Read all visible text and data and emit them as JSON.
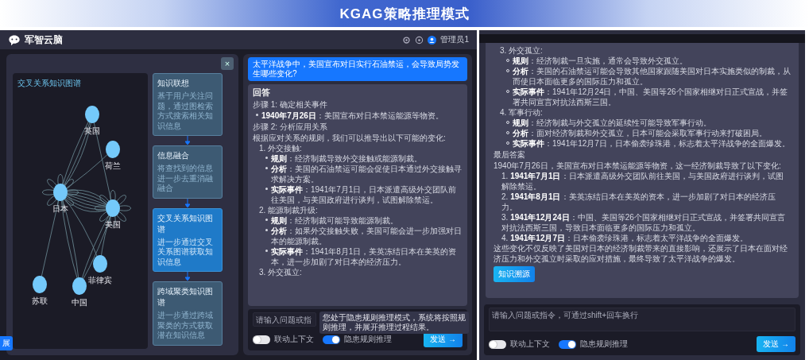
{
  "banner": {
    "title": "KGAG策略推理模式"
  },
  "left_screen": {
    "header": {
      "logo": "军智云脑",
      "user": "管理员1"
    },
    "graph_panel": {
      "close": "×",
      "title": "交叉关系知识图谱",
      "side_button": "展",
      "nodes": [
        {
          "label": "英国"
        },
        {
          "label": "荷兰"
        },
        {
          "label": "日本"
        },
        {
          "label": "美国"
        },
        {
          "label": "菲律宾"
        },
        {
          "label": "苏联"
        },
        {
          "label": "中国"
        }
      ]
    },
    "steps": [
      {
        "title": "知识联想",
        "description": "基于用户关注问题，通过图检索方式搜索相关知识信息",
        "selected": false
      },
      {
        "title": "信息融合",
        "description": "将查找到的信息进一步去重消融融合",
        "selected": false
      },
      {
        "title": "交叉关系知识图谱",
        "description": "进一步通过交叉关系图谱获取知识信息",
        "selected": true
      },
      {
        "title": "跨域聚类知识图谱",
        "description": "进一步通过跨域聚类的方式获取潜在知识信息",
        "selected": false
      }
    ],
    "chat": {
      "question": "太平洋战争中，美国宣布对日实行石油禁运，会导致局势发生哪些变化?",
      "answer": {
        "blocks": [
          {
            "kind": "title",
            "text": "回答"
          },
          {
            "kind": "step",
            "text": "步骤 1: 确定相关事件"
          },
          {
            "kind": "bullet",
            "text": "**1940年7月26日**：美国宣布对日本禁运能源等物资。"
          },
          {
            "kind": "step",
            "text": "步骤 2: 分析应用关系"
          },
          {
            "kind": "para",
            "text": "根据应对关系的规则，我们可以推导出以下可能的变化:"
          },
          {
            "kind": "item",
            "text": "1. 外交接触:"
          },
          {
            "kind": "sub",
            "text": "**规则**：经济制裁导致外交接触或能源制裁。"
          },
          {
            "kind": "sub",
            "text": "**分析**：美国的石油禁运可能会促使日本通过外交接触寻求解决方案。"
          },
          {
            "kind": "sub",
            "text": "**实际事件**：1941年7月1日，日本派遣高级外交团队前往美国，与美国政府进行谈判，试图解除禁运。"
          },
          {
            "kind": "item",
            "text": "2. 能源制裁升级:"
          },
          {
            "kind": "sub",
            "text": "**规则**：经济制裁可能导致能源制裁。"
          },
          {
            "kind": "sub",
            "text": "**分析**：如果外交接触失败，美国可能会进一步加强对日本的能源制裁。"
          },
          {
            "kind": "sub",
            "text": "**实际事件**：1941年8月1日，美英冻结日本在美英的资本，进一步加剧了对日本的经济压力。"
          },
          {
            "kind": "item",
            "text": "3. 外交孤立:"
          }
        ]
      },
      "input": {
        "placeholder": "请输入问题或指",
        "tooltip": "您处于隐患规则推理模式，系统将按照规则推理，并展开推理过程结果。"
      },
      "toggles": [
        {
          "label": "联动上下文",
          "on": false
        },
        {
          "label": "隐患规则推理",
          "on": true
        }
      ],
      "send": "发送 →"
    }
  },
  "right_screen": {
    "answer": {
      "blocks": [
        {
          "kind": "item",
          "text": "3. 外交孤立:"
        },
        {
          "kind": "sub",
          "text": "**规则**：经济制裁一旦实施，通常会导致外交孤立。"
        },
        {
          "kind": "sub",
          "text": "**分析**：美国的石油禁运可能会导致其他国家跟随美国对日本实施类似的制裁，从而使日本面临更多的国际压力和孤立。"
        },
        {
          "kind": "sub",
          "text": "**实际事件**：1941年12月24日，中国、美国等26个国家相继对日正式宣战，并签署共同宣言对抗法西斯三国。"
        },
        {
          "kind": "item",
          "text": "4. 军事行动:"
        },
        {
          "kind": "sub",
          "text": "**规则**：经济制裁与外交孤立的延续性可能导致军事行动。"
        },
        {
          "kind": "sub",
          "text": "**分析**：面对经济制裁和外交孤立，日本可能会采取军事行动来打破困局。"
        },
        {
          "kind": "sub",
          "text": "**实际事件**：1941年12月7日，日本偷袭珍珠港，标志着太平洋战争的全面爆发。"
        },
        {
          "kind": "step",
          "text": "最后答案"
        },
        {
          "kind": "para",
          "text": "1940年7月26日，美国宣布对日本禁运能源等物资，这一经济制裁导致了以下变化:"
        },
        {
          "kind": "num",
          "text": "1. **1941年7月1日**：日本派遣高级外交团队前往美国，与美国政府进行谈判，试图解除禁运。"
        },
        {
          "kind": "num",
          "text": "2. **1941年8月1日**：美英冻结日本在美英的资本，进一步加剧了对日本的经济压力。"
        },
        {
          "kind": "num",
          "text": "3. **1941年12月24日**：中国、美国等26个国家相继对日正式宣战，并签署共同宣言对抗法西斯三国，导致日本面临更多的国际压力和孤立。"
        },
        {
          "kind": "num",
          "text": "4. **1941年12月7日**：日本偷袭珍珠港，标志着太平洋战争的全面爆发。"
        },
        {
          "kind": "para",
          "text": "这些变化不仅反映了美国对日本的经济制裁带来的直接影响，还展示了日本在面对经济压力和外交孤立时采取的应对措施，最终导致了太平洋战争的爆发。"
        }
      ],
      "source_button": "知识溯源"
    },
    "input": {
      "placeholder": "请输入问题或指令，可通过shift+回车换行"
    },
    "toggles": [
      {
        "label": "联动上下文",
        "on": false
      },
      {
        "label": "隐患规则推理",
        "on": true
      }
    ],
    "send": "发送 →"
  }
}
